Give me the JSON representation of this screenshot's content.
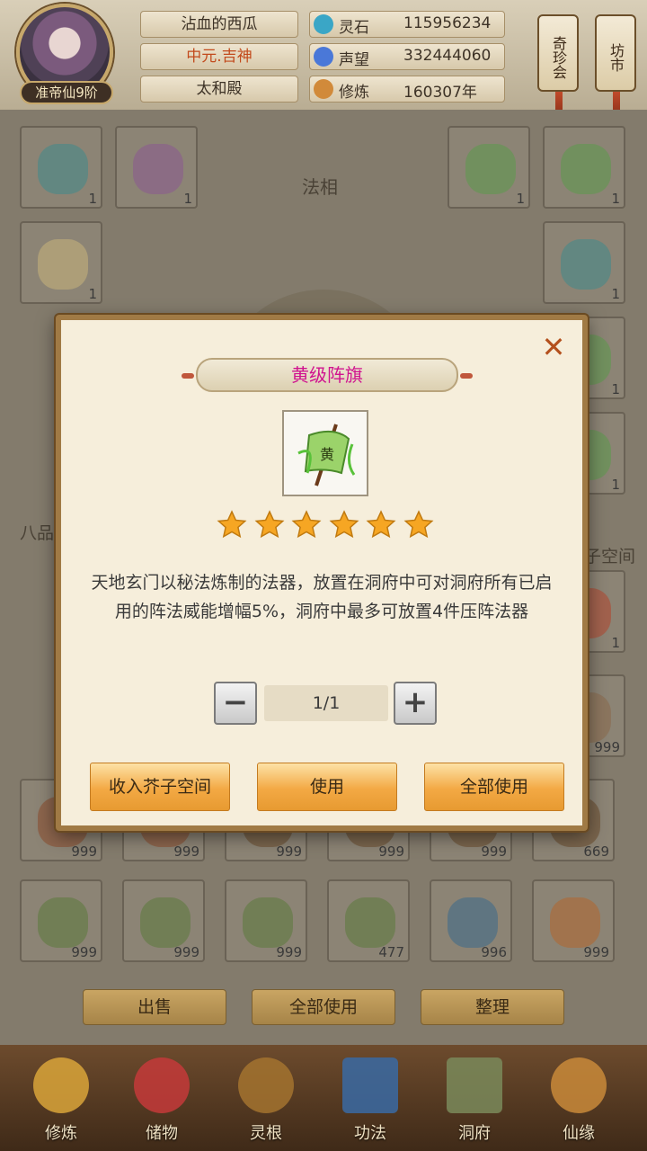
{
  "header": {
    "realm": "准帝仙9阶",
    "name": "沾血的西瓜",
    "server": "中元.吉神",
    "location": "太和殿",
    "resources": [
      {
        "label": "灵石",
        "value": "115956234",
        "icon": "spirit-stone-icon",
        "color": "#3aa6c6"
      },
      {
        "label": "声望",
        "value": "332444060",
        "icon": "prestige-crystal-icon",
        "color": "#4a78d8"
      },
      {
        "label": "修炼",
        "value": "160307年",
        "icon": "meditation-icon",
        "color": "#d18a3a"
      }
    ],
    "scroll_buttons": [
      "奇珍会",
      "坊市"
    ]
  },
  "background": {
    "figure_label": "法相",
    "section_left": "八品",
    "section_right": "子空间",
    "slot_counts_row1": [
      "1",
      "1",
      "1",
      "1"
    ],
    "slot_counts_row2": [
      "1",
      "1"
    ],
    "slot_counts_row3": [
      "1",
      "1"
    ],
    "slot_counts_row4": [
      "1",
      "1"
    ],
    "slot_counts_row5": [
      "1"
    ],
    "slot_counts_row6": [
      "999"
    ],
    "slot_counts_row7": [
      "999",
      "999",
      "999",
      "999",
      "999",
      "669"
    ],
    "slot_counts_row8": [
      "999",
      "999",
      "999",
      "477",
      "996",
      "999"
    ],
    "bottom_buttons": [
      "出售",
      "全部使用",
      "整理"
    ]
  },
  "nav": {
    "items": [
      "修炼",
      "储物",
      "灵根",
      "功法",
      "洞府",
      "仙缘"
    ]
  },
  "modal": {
    "title": "黄级阵旗",
    "item_icon": "yellow-array-flag-icon",
    "flag_char": "黄",
    "stars": 6,
    "description": "天地玄门以秘法炼制的法器，放置在洞府中可对洞府所有已启用的阵法威能增幅5%，洞府中最多可放置4件压阵法器",
    "quantity": "1/1",
    "minus_label": "−",
    "plus_label": "+",
    "close_label": "✕",
    "actions": [
      "收入芥子空间",
      "使用",
      "全部使用"
    ],
    "colors": {
      "title": "#d0138f",
      "button": "#f3a944",
      "star": "#f6a623"
    }
  }
}
